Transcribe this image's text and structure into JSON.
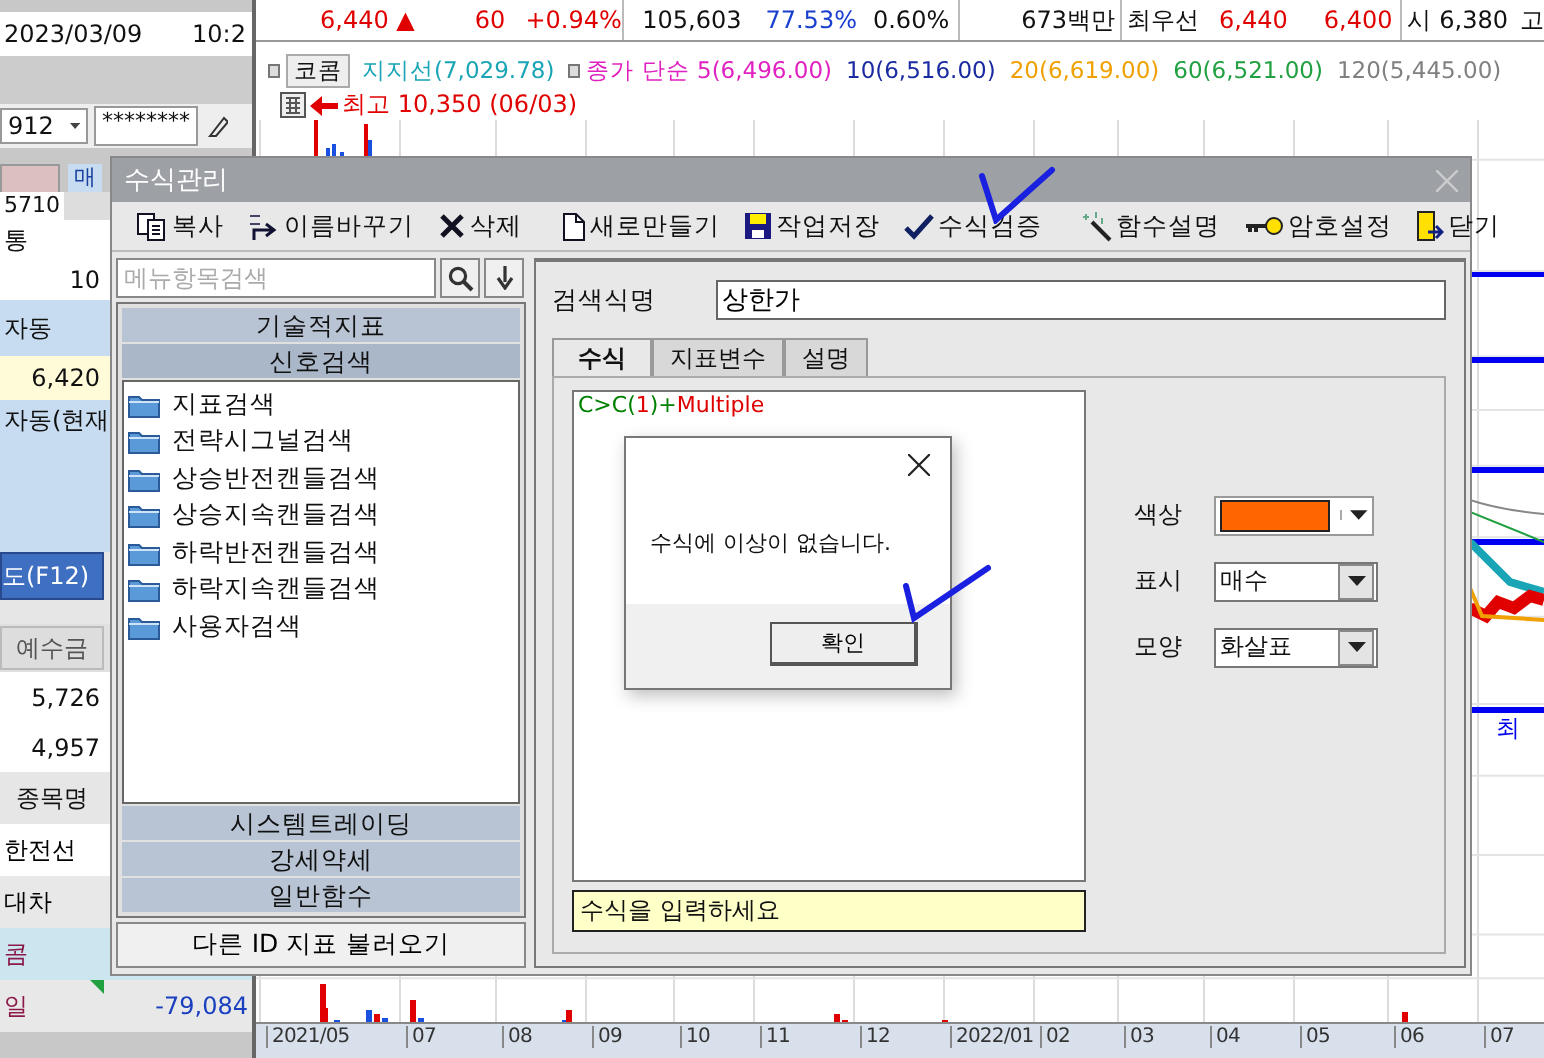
{
  "left_panel": {
    "date": "2023/03/09",
    "time": "10:2",
    "account": "912",
    "password": "********",
    "tab": "매",
    "code": "5710",
    "type_value": "통",
    "quantity": "10",
    "price_mode": "자동",
    "price": "6,420",
    "price_mode_2": "자동(현재",
    "order_button": "도(F12)",
    "deposit_header": "예수금",
    "deposit_values": [
      "5,726",
      "4,957"
    ],
    "stock_header": "종목명",
    "stocks": [
      {
        "name": "한전선",
        "color": "#000000",
        "selected": false
      },
      {
        "name": "대차",
        "color": "#000000",
        "selected": false
      },
      {
        "name": "콤",
        "color": "#8b1a4a",
        "selected": true
      },
      {
        "name": "일",
        "color": "#8b1a4a",
        "selected": false,
        "amount": "-79,084"
      }
    ]
  },
  "ticker": {
    "price": "6,440",
    "change_sign": "▲",
    "change": "60",
    "change_rate": "+0.94%",
    "volume": "105,603",
    "volume_ratio": "77.53%",
    "turnover": "0.60%",
    "trade_value": "673백만",
    "best_label": "최우선",
    "ask": "6,440",
    "bid": "6,400",
    "open_label": "시",
    "open": "6,380",
    "high_label": "고"
  },
  "chart": {
    "stock_name": "코콤",
    "legend": [
      {
        "text": "지지선(7,029.78)",
        "color": "#19a5b5"
      },
      {
        "text": "종가 단순 5(6,496.00)",
        "color": "#e020c0"
      },
      {
        "text": "10(6,516.00)",
        "color": "#1a2aa0"
      },
      {
        "text": "20(6,619.00)",
        "color": "#f0a000"
      },
      {
        "text": "60(6,521.00)",
        "color": "#20a040"
      },
      {
        "text": "120(5,445.00)",
        "color": "#808080"
      }
    ],
    "high_marker": "최고 10,350 (06/03)",
    "low_label": "최",
    "x_labels": [
      "2021/05",
      "07",
      "08",
      "09",
      "10",
      "11",
      "12",
      "2022/01",
      "02",
      "03",
      "04",
      "05",
      "06",
      "07"
    ]
  },
  "dialog": {
    "title": "수식관리",
    "toolbar": [
      {
        "label": "복사"
      },
      {
        "label": "이름바꾸기"
      },
      {
        "label": "삭제"
      },
      {
        "label": "새로만들기"
      },
      {
        "label": "작업저장"
      },
      {
        "label": "수식검증"
      },
      {
        "label": "함수설명"
      },
      {
        "label": "암호설정"
      },
      {
        "label": "닫기"
      }
    ],
    "search": {
      "placeholder": "메뉴항목검색"
    },
    "categories": [
      {
        "label": "기술적지표",
        "expanded": false
      },
      {
        "label": "신호검색",
        "expanded": true,
        "children": [
          {
            "label": "지표검색"
          },
          {
            "label": "전략시그널검색"
          },
          {
            "label": "상승반전캔들검색"
          },
          {
            "label": "상승지속캔들검색"
          },
          {
            "label": "하락반전캔들검색"
          },
          {
            "label": "하락지속캔들검색"
          },
          {
            "label": "사용자검색"
          }
        ]
      },
      {
        "label": "시스템트레이딩",
        "expanded": false
      },
      {
        "label": "강세약세",
        "expanded": false
      },
      {
        "label": "일반함수",
        "expanded": false
      }
    ],
    "load_button": "다른 ID 지표 불러오기",
    "formula_name": {
      "label": "검색식명",
      "value": "상한가"
    },
    "tabs": [
      {
        "label": "수식",
        "selected": true
      },
      {
        "label": "지표변수",
        "selected": false
      },
      {
        "label": "설명",
        "selected": false
      }
    ],
    "formula": [
      {
        "text": "C>C(",
        "kind": "variable"
      },
      {
        "text": "1",
        "kind": "number"
      },
      {
        "text": ")+",
        "kind": "variable"
      },
      {
        "text": "Multiple",
        "kind": "function"
      }
    ],
    "hint": "수식을 입력하세요",
    "settings": [
      {
        "label": "색상",
        "kind": "color",
        "color": "#ff6600"
      },
      {
        "label": "표시",
        "kind": "select",
        "value": "매수"
      },
      {
        "label": "모양",
        "kind": "select",
        "value": "화살표"
      }
    ]
  },
  "message_box": {
    "text": "수식에 이상이 없습니다.",
    "button": "확인"
  }
}
